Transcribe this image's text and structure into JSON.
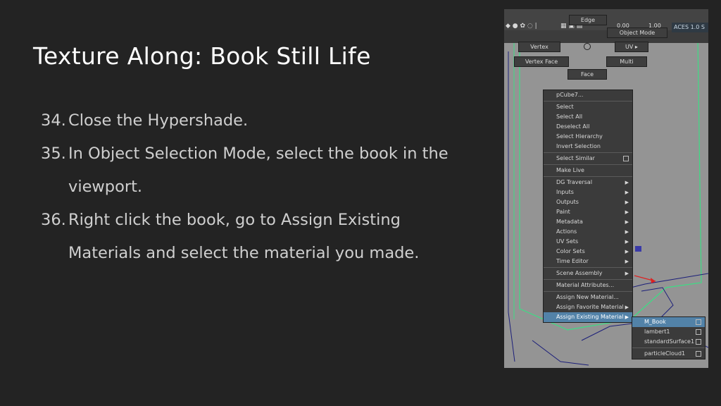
{
  "slide": {
    "title": "Texture Along: Book Still Life",
    "steps": [
      {
        "num": "34.",
        "text": "Close the Hypershade."
      },
      {
        "num": "35.",
        "text": "In Object Selection Mode, select the book in the viewport."
      },
      {
        "num": "36.",
        "text": "Right click the book, go to Assign Existing Materials and select the material you made."
      }
    ]
  },
  "maya": {
    "toolbar": {
      "num1": "0.00",
      "num2": "1.00",
      "aces": "ACES 1.0 S"
    },
    "marking_menu": {
      "edge": "Edge",
      "object_mode": "Object Mode",
      "vertex": "Vertex",
      "uv": "UV",
      "vertex_face": "Vertex Face",
      "multi": "Multi",
      "face": "Face"
    },
    "context_menu": [
      {
        "label": "pCube7...",
        "type": "item"
      },
      {
        "type": "sep"
      },
      {
        "label": "Select",
        "type": "item"
      },
      {
        "label": "Select All",
        "type": "item"
      },
      {
        "label": "Deselect All",
        "type": "item"
      },
      {
        "label": "Select Hierarchy",
        "type": "item"
      },
      {
        "label": "Invert Selection",
        "type": "item"
      },
      {
        "type": "sep"
      },
      {
        "label": "Select Similar",
        "type": "box"
      },
      {
        "type": "sep"
      },
      {
        "label": "Make Live",
        "type": "item"
      },
      {
        "type": "sep"
      },
      {
        "label": "DG Traversal",
        "type": "sub"
      },
      {
        "label": "Inputs",
        "type": "sub"
      },
      {
        "label": "Outputs",
        "type": "sub"
      },
      {
        "label": "Paint",
        "type": "sub"
      },
      {
        "label": "Metadata",
        "type": "sub"
      },
      {
        "label": "Actions",
        "type": "sub"
      },
      {
        "label": "UV Sets",
        "type": "sub"
      },
      {
        "label": "Color Sets",
        "type": "sub"
      },
      {
        "label": "Time Editor",
        "type": "sub"
      },
      {
        "type": "sep"
      },
      {
        "label": "Scene Assembly",
        "type": "sub"
      },
      {
        "type": "sep"
      },
      {
        "label": "Material Attributes...",
        "type": "item"
      },
      {
        "type": "sep"
      },
      {
        "label": "Assign New Material...",
        "type": "item"
      },
      {
        "label": "Assign Favorite Material",
        "type": "sub"
      },
      {
        "label": "Assign Existing Material",
        "type": "sub",
        "highlight": true
      }
    ],
    "submenu": [
      {
        "label": "M_Book",
        "highlight": true
      },
      {
        "label": "lambert1"
      },
      {
        "label": "standardSurface1"
      },
      {
        "type": "sep"
      },
      {
        "label": "particleCloud1"
      }
    ],
    "colors": {
      "highlight": "#5282a8",
      "wire_green": "#3ddc84",
      "wire_blue": "#1c1f7a",
      "viewport": "#949494"
    }
  }
}
